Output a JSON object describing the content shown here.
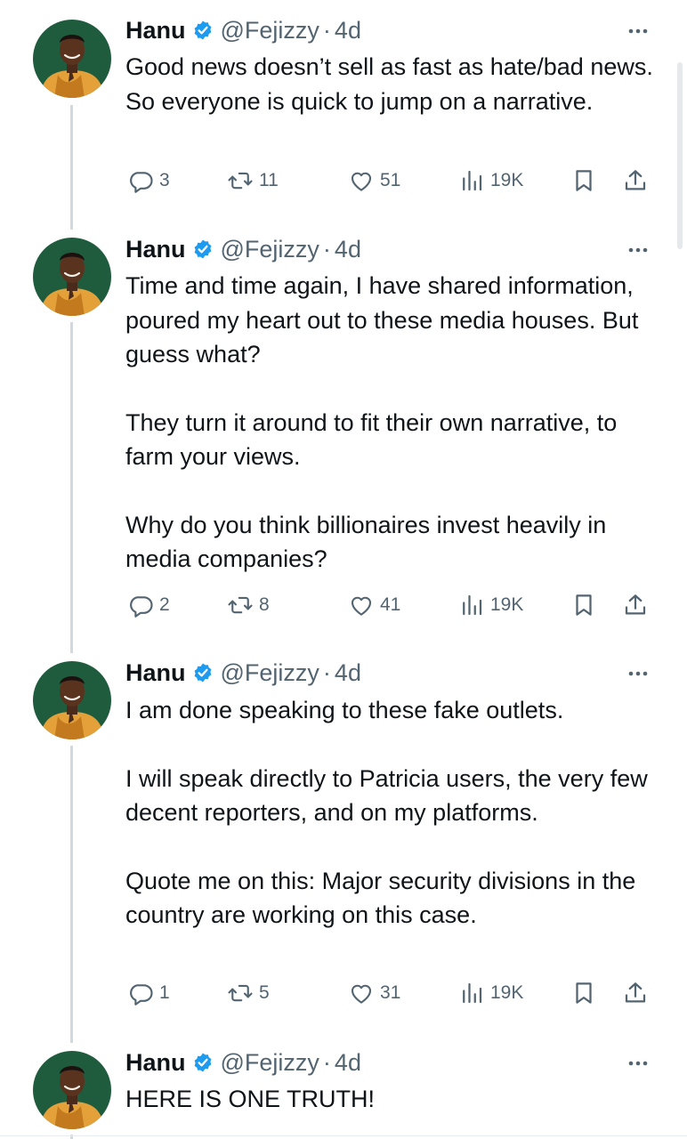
{
  "colors": {
    "accent": "#1d9bf0",
    "text": "#0f1419",
    "muted": "#536471",
    "thread_line": "#cfd9de"
  },
  "icons": {
    "verified": "verified-badge-icon",
    "more": "more-dots-icon",
    "reply": "reply-icon",
    "retweet": "retweet-icon",
    "like": "heart-icon",
    "views": "views-chart-icon",
    "bookmark": "bookmark-icon",
    "share": "share-icon"
  },
  "tweets": [
    {
      "author": {
        "name": "Hanu",
        "handle": "@Fejizzy",
        "separator": "·",
        "time": "4d"
      },
      "paragraphs": [
        "Good news doesn’t sell as fast as hate/bad news. So everyone is quick to jump on a narrative."
      ],
      "stats": {
        "replies": "3",
        "retweets": "11",
        "likes": "51",
        "views": "19K"
      }
    },
    {
      "author": {
        "name": "Hanu",
        "handle": "@Fejizzy",
        "separator": "·",
        "time": "4d"
      },
      "paragraphs": [
        "Time and time again, I have shared information, poured my heart out to these media houses. But guess what?",
        "They turn it around to fit their own narrative, to farm your views.",
        "Why do you think billionaires invest heavily in media companies?"
      ],
      "stats": {
        "replies": "2",
        "retweets": "8",
        "likes": "41",
        "views": "19K"
      }
    },
    {
      "author": {
        "name": "Hanu",
        "handle": "@Fejizzy",
        "separator": "·",
        "time": "4d"
      },
      "paragraphs": [
        "I am done speaking to these fake outlets.",
        "I will speak directly to Patricia users, the very few decent reporters, and on my platforms.",
        "Quote me on this: Major security divisions in the country are working on this case."
      ],
      "stats": {
        "replies": "1",
        "retweets": "5",
        "likes": "31",
        "views": "19K"
      }
    },
    {
      "author": {
        "name": "Hanu",
        "handle": "@Fejizzy",
        "separator": "·",
        "time": "4d"
      },
      "paragraphs": [
        "HERE IS ONE TRUTH!"
      ]
    }
  ]
}
